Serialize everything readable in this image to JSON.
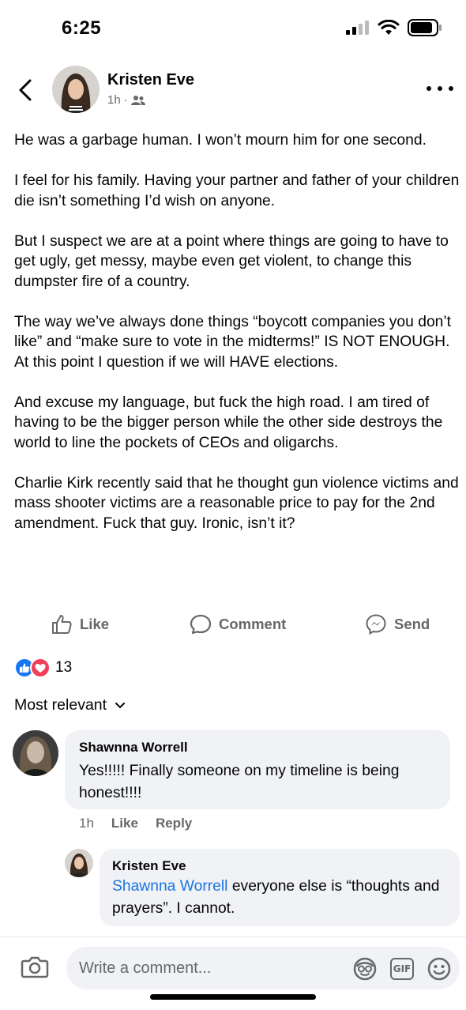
{
  "status_bar": {
    "time": "6:25"
  },
  "post": {
    "author": "Kristen Eve",
    "time": "1h",
    "separator": "·",
    "paragraphs": [
      "He was a garbage human. I won’t mourn him for one second.",
      "I feel for his family. Having your partner and father of your children die isn’t something I’d wish on anyone.",
      "But I suspect we are at a point where things are going to have to get ugly, get messy, maybe even get violent, to change this dumpster fire of a country.",
      "The way we’ve always done things “boycott companies you don’t like” and “make sure to vote in the midterms!” IS NOT ENOUGH. At this point I question if we will HAVE elections.",
      "And excuse my language, but fuck the high road. I am tired of having to be the bigger person while the other side destroys the world to line the pockets of CEOs and oligarchs.",
      "Charlie Kirk recently said that he thought gun violence victims and mass shooter victims are a reasonable price to pay for the 2nd amendment. Fuck that guy. Ironic, isn’t it?"
    ]
  },
  "actions": {
    "like": "Like",
    "comment": "Comment",
    "send": "Send"
  },
  "reactions": {
    "count": "13"
  },
  "sort": {
    "label": "Most relevant"
  },
  "comments": [
    {
      "name": "Shawnna Worrell",
      "text": "Yes!!!!! Finally someone on my timeline is being honest!!!!",
      "time": "1h",
      "like": "Like",
      "reply": "Reply"
    }
  ],
  "reply": {
    "name": "Kristen Eve",
    "mention": "Shawnna Worrell",
    "text": " everyone else is “thoughts and prayers”. I cannot."
  },
  "composer": {
    "placeholder": "Write a comment...",
    "gif": "GIF"
  },
  "colors": {
    "link": "#1b74e4",
    "like_blue": "#1877f2",
    "love_red": "#f33e58",
    "secondary": "#65676b"
  }
}
